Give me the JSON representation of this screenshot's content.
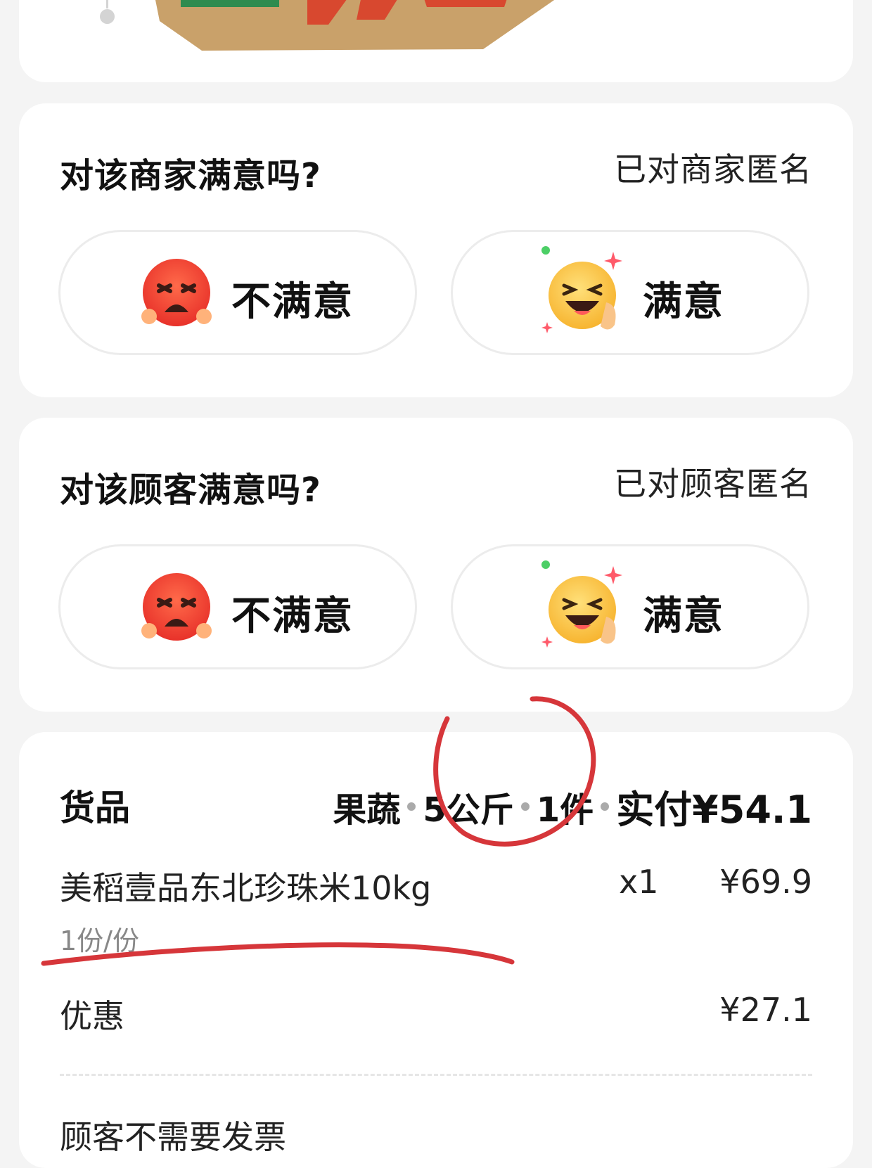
{
  "top_card": {
    "illustration": "cardboard-box-icon"
  },
  "merchant_rating": {
    "question": "对该商家满意吗?",
    "anonymous_note": "已对商家匿名",
    "unsatisfied_label": "不满意",
    "satisfied_label": "满意"
  },
  "customer_rating": {
    "question": "对该顾客满意吗?",
    "anonymous_note": "已对顾客匿名",
    "unsatisfied_label": "不满意",
    "satisfied_label": "满意"
  },
  "goods": {
    "title": "货品",
    "summary": {
      "category": "果蔬",
      "weight": "5公斤",
      "count": "1件",
      "paid": "实付¥54.1"
    },
    "item": {
      "name": "美稻壹品东北珍珠米10kg",
      "qty": "x1",
      "price": "¥69.9",
      "spec": "1份/份"
    },
    "discount_label": "优惠",
    "discount_value": "¥27.1",
    "invoice_note": "顾客不需要发票"
  },
  "colors": {
    "background": "#f4f4f4",
    "card": "#ffffff",
    "annotation_red": "#d6363a"
  }
}
